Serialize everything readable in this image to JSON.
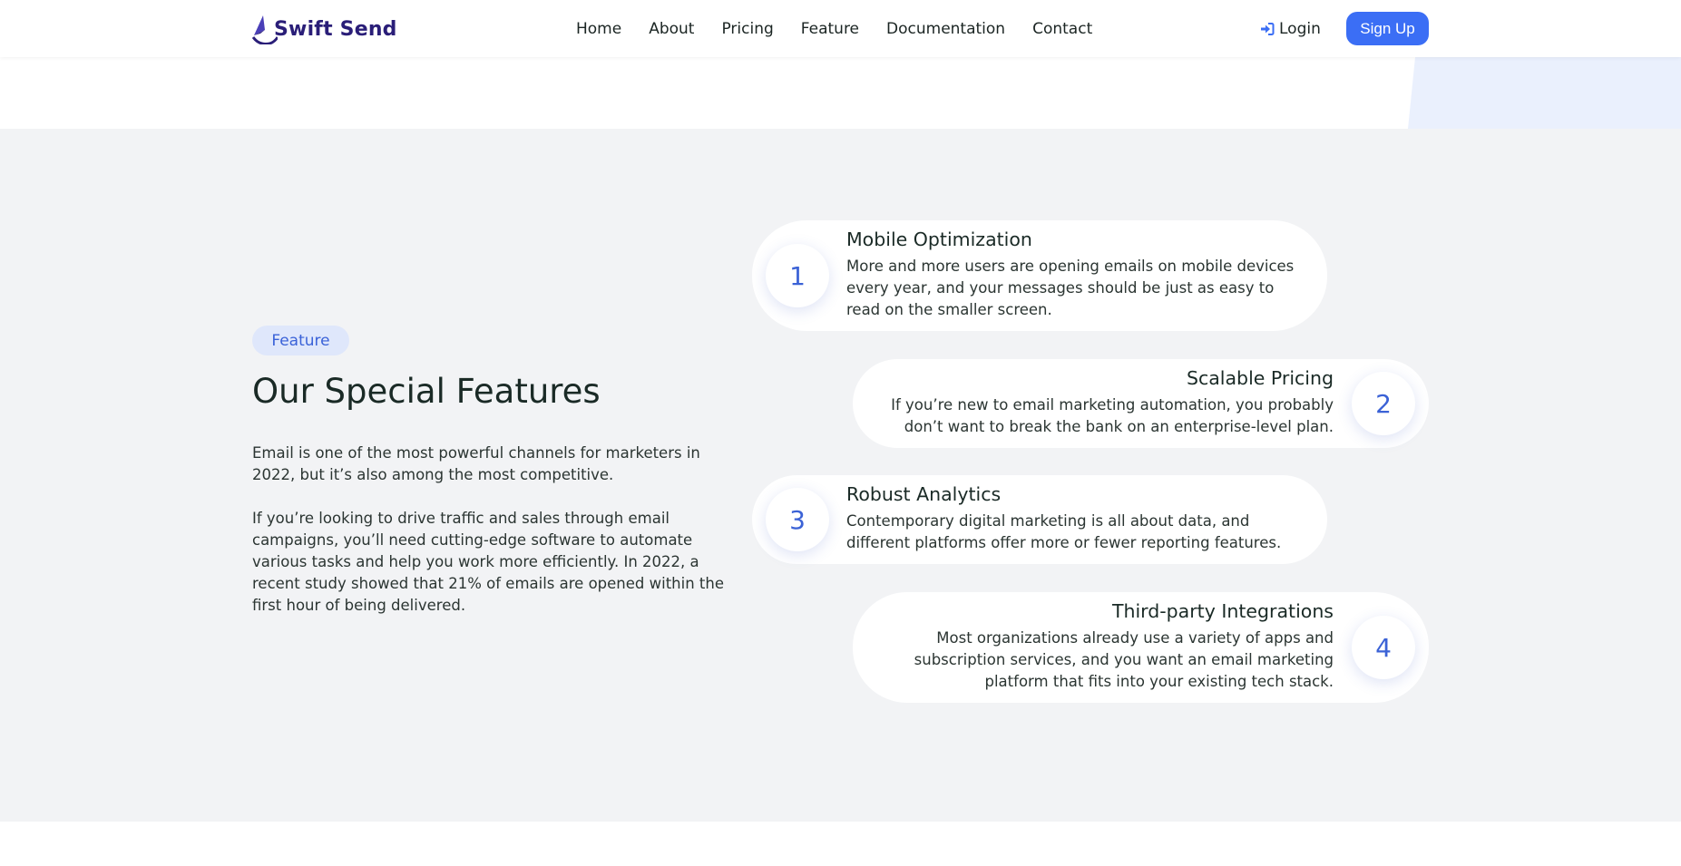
{
  "header": {
    "logo_text": "Swift Send",
    "nav": [
      "Home",
      "About",
      "Pricing",
      "Feature",
      "Documentation",
      "Contact"
    ],
    "login_label": "Login",
    "signup_label": "Sign Up"
  },
  "features_section": {
    "badge": "Feature",
    "heading": "Our Special Features",
    "paragraph1": "Email is one of the most powerful channels for marketers in 2022, but it’s also among the most competitive.",
    "paragraph2": "If you’re looking to drive traffic and sales through email campaigns, you’ll need cutting-edge software to automate various tasks and help you work more efficiently. In 2022, a recent study showed that 21% of emails are opened within the first hour of being delivered.",
    "items": [
      {
        "number": "1",
        "title": "Mobile Optimization",
        "description": "More and more users are opening emails on mobile devices every year, and your messages should be just as easy to read on the smaller screen."
      },
      {
        "number": "2",
        "title": "Scalable Pricing",
        "description": "If you’re new to email marketing automation, you probably don’t want to break the bank on an enterprise-level plan."
      },
      {
        "number": "3",
        "title": "Robust Analytics",
        "description": "Contemporary digital marketing is all about data, and different platforms offer more or fewer reporting features."
      },
      {
        "number": "4",
        "title": "Third-party Integrations",
        "description": "Most organizations already use a variety of apps and subscription services, and you want an email marketing platform that fits into your existing tech stack."
      }
    ]
  },
  "colors": {
    "primary": "#3b6ef5",
    "logo": "#2a1e78",
    "section_bg": "#f2f3f5",
    "badge_bg": "#dfe7fb"
  },
  "icons": {
    "login": "sign-in-icon",
    "logo": "paper-plane-swoosh-icon"
  }
}
